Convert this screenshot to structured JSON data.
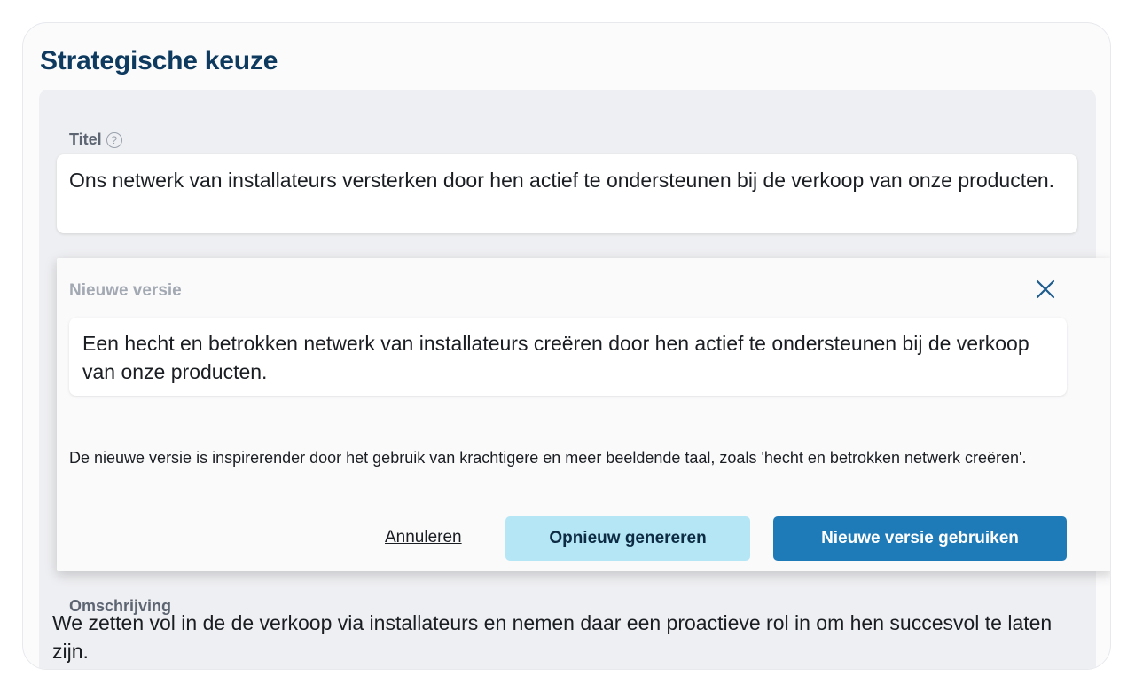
{
  "card": {
    "title": "Strategische keuze"
  },
  "title_field": {
    "label": "Titel",
    "help_icon": "?",
    "value": "Ons netwerk van installateurs versterken door hen actief te ondersteunen bij de verkoop van onze producten."
  },
  "suggestion": {
    "label": "Nieuwe versie",
    "close_icon": "close-icon",
    "new_text": "Een hecht en betrokken netwerk van installateurs creëren door hen actief te ondersteunen bij de verkoop van onze producten.",
    "explanation": "De nieuwe versie is inspirerender door het gebruik van krachtigere en meer beeldende taal, zoals 'hecht en betrokken netwerk creëren'.",
    "cancel_label": "Annuleren",
    "regenerate_label": "Opnieuw genereren",
    "use_label": "Nieuwe versie gebruiken"
  },
  "description_field": {
    "label": "Omschrijving",
    "value": "We zetten vol in de de verkoop via installateurs en nemen daar een proactieve rol in om hen succesvol te laten zijn."
  },
  "colors": {
    "heading": "#0d3a5e",
    "regenerate_bg": "#b4e6f6",
    "primary": "#1f7ab8"
  }
}
